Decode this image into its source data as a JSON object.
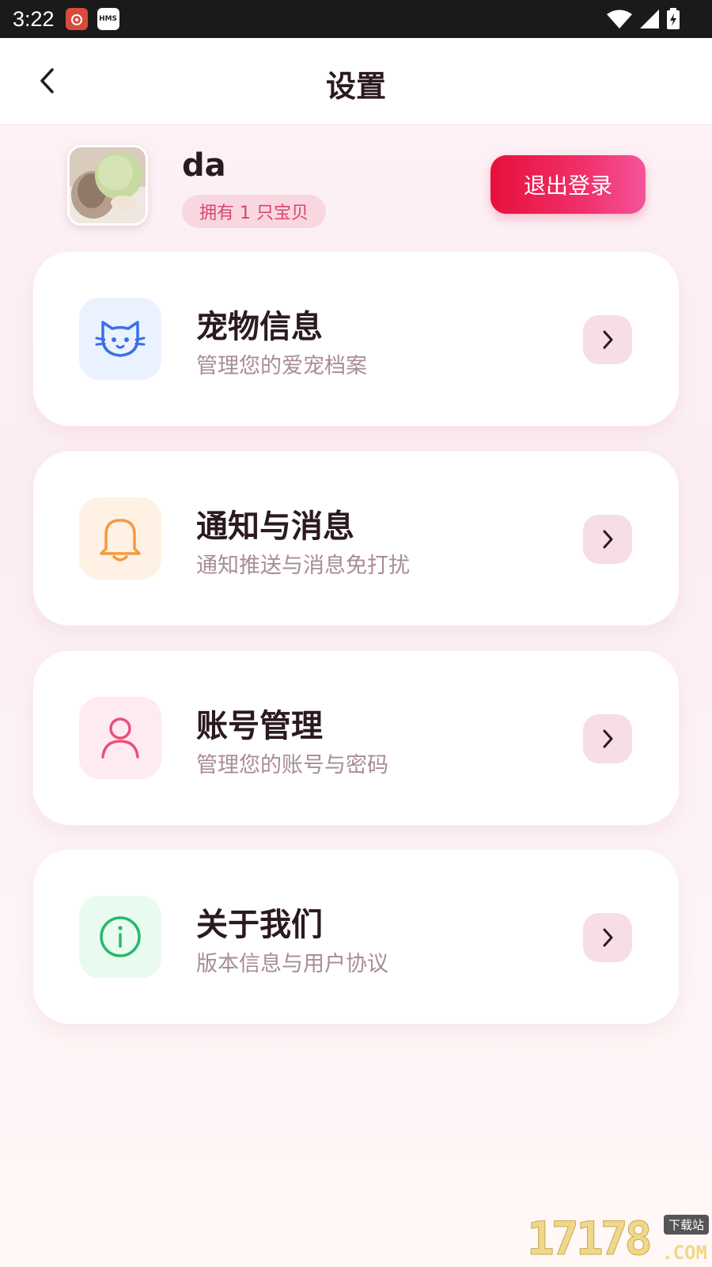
{
  "status_bar": {
    "time": "3:22",
    "apps": [
      "weibo-icon",
      "hms-icon"
    ],
    "hms_label": "HMS"
  },
  "header": {
    "title": "设置",
    "back_icon": "chevron-left-icon"
  },
  "profile": {
    "username": "da",
    "pet_count_label": "拥有 1 只宝贝",
    "logout_label": "退出登录"
  },
  "menu": {
    "items": [
      {
        "title": "宠物信息",
        "subtitle": "管理您的爱宠档案",
        "icon": "cat-icon",
        "icon_color": "#3b6fe6",
        "icon_bg": "#eaf2ff"
      },
      {
        "title": "通知与消息",
        "subtitle": "通知推送与消息免打扰",
        "icon": "bell-icon",
        "icon_color": "#f39a3e",
        "icon_bg": "#fff1e4"
      },
      {
        "title": "账号管理",
        "subtitle": "管理您的账号与密码",
        "icon": "user-icon",
        "icon_color": "#e8507a",
        "icon_bg": "#fdebf1"
      },
      {
        "title": "关于我们",
        "subtitle": "版本信息与用户协议",
        "icon": "info-icon",
        "icon_color": "#27b96a",
        "icon_bg": "#e9fbef"
      }
    ]
  },
  "colors": {
    "accent": "#e8103b",
    "title_text": "#2b1a20",
    "subtitle_text": "#a88c98",
    "chevron_bg": "#f7dde6"
  },
  "watermark": {
    "digits": "17178",
    "tag": "下载站",
    "suffix": ".COM"
  }
}
